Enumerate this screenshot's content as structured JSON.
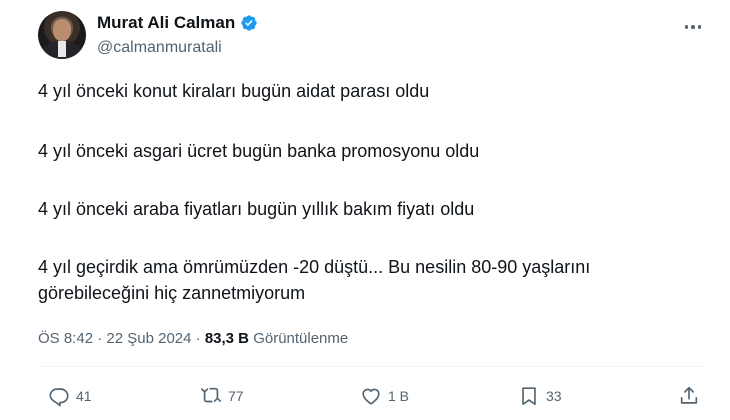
{
  "author": {
    "name": "Murat Ali Calman",
    "handle": "@calmanmuratali",
    "verified": true
  },
  "tweet": {
    "paragraphs": [
      "4 yıl önceki konut kiraları bugün aidat parası oldu",
      "4 yıl önceki asgari ücret bugün banka promosyonu oldu",
      "4 yıl önceki araba fiyatları bugün yıllık bakım fiyatı oldu",
      "4 yıl geçirdik ama ömrümüzden -20 düştü... Bu nesilin 80-90 yaşlarını",
      "görebileceğini hiç zannetmiyorum"
    ],
    "time": "ÖS 8:42",
    "separator": "·",
    "date": "22 Şub 2024",
    "views_count": "83,3 B",
    "views_label": "Görüntülenme"
  },
  "actions": {
    "replies": "41",
    "retweets": "77",
    "likes": "1 B",
    "bookmarks": "33"
  },
  "colors": {
    "text": "#0f1419",
    "secondary": "#536471",
    "verified": "#1d9bf0"
  },
  "icons": [
    "verified-badge-icon",
    "more-icon",
    "reply-icon",
    "retweet-icon",
    "like-icon",
    "bookmark-icon",
    "share-icon"
  ]
}
